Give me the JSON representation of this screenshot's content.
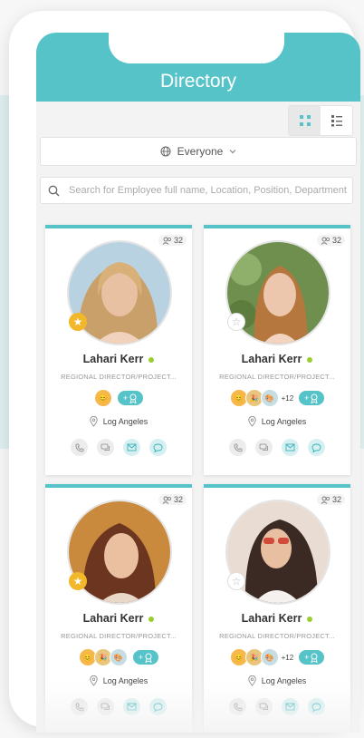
{
  "header": {
    "title": "Directory"
  },
  "view_toggle": {
    "grid_icon": "grid-view-icon",
    "list_icon": "list-view-icon",
    "active": "grid"
  },
  "filter": {
    "label": "Everyone",
    "globe_icon": "globe-icon",
    "chevron_icon": "chevron-down-icon"
  },
  "search": {
    "placeholder": "Search for Employee full name, Location, Position, Department a"
  },
  "colors": {
    "accent": "#56c3c9",
    "online": "#9ccd2e",
    "star": "#f3b72a"
  },
  "cards": [
    {
      "name": "Lahari Kerr",
      "role": "REGIONAL DIRECTOR/PROJECT...",
      "count": "32",
      "location": "Log Angeles",
      "favorite": true,
      "extra_badges": ""
    },
    {
      "name": "Lahari Kerr",
      "role": "REGIONAL DIRECTOR/PROJECT...",
      "count": "32",
      "location": "Log Angeles",
      "favorite": false,
      "extra_badges": "+12"
    },
    {
      "name": "Lahari Kerr",
      "role": "REGIONAL DIRECTOR/PROJECT...",
      "count": "32",
      "location": "Log Angeles",
      "favorite": true,
      "extra_badges": ""
    },
    {
      "name": "Lahari Kerr",
      "role": "REGIONAL DIRECTOR/PROJECT...",
      "count": "32",
      "location": "Log Angeles",
      "favorite": false,
      "extra_badges": "+12"
    }
  ],
  "badge_add_label": "+",
  "action_icons": [
    "phone-icon",
    "chat-icon",
    "mail-icon",
    "message-icon"
  ]
}
